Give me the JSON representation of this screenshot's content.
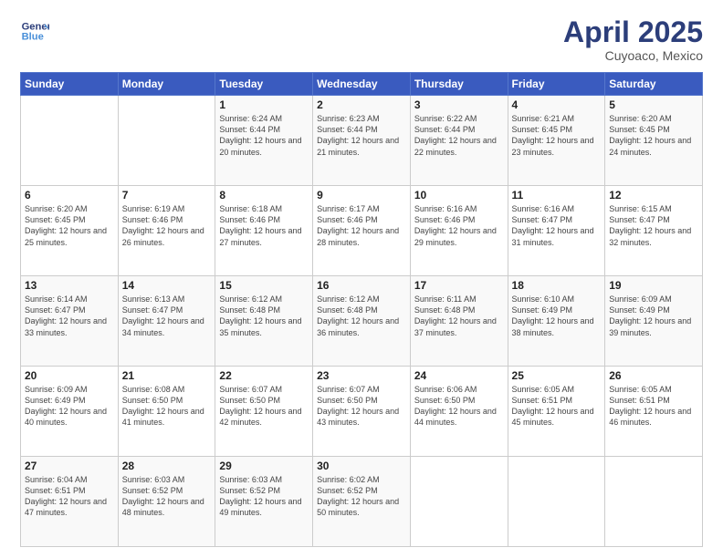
{
  "header": {
    "logo_line1": "General",
    "logo_line2": "Blue",
    "month_title": "April 2025",
    "subtitle": "Cuyoaco, Mexico"
  },
  "days_of_week": [
    "Sunday",
    "Monday",
    "Tuesday",
    "Wednesday",
    "Thursday",
    "Friday",
    "Saturday"
  ],
  "weeks": [
    [
      {
        "day": "",
        "info": ""
      },
      {
        "day": "",
        "info": ""
      },
      {
        "day": "1",
        "info": "Sunrise: 6:24 AM\nSunset: 6:44 PM\nDaylight: 12 hours and 20 minutes."
      },
      {
        "day": "2",
        "info": "Sunrise: 6:23 AM\nSunset: 6:44 PM\nDaylight: 12 hours and 21 minutes."
      },
      {
        "day": "3",
        "info": "Sunrise: 6:22 AM\nSunset: 6:44 PM\nDaylight: 12 hours and 22 minutes."
      },
      {
        "day": "4",
        "info": "Sunrise: 6:21 AM\nSunset: 6:45 PM\nDaylight: 12 hours and 23 minutes."
      },
      {
        "day": "5",
        "info": "Sunrise: 6:20 AM\nSunset: 6:45 PM\nDaylight: 12 hours and 24 minutes."
      }
    ],
    [
      {
        "day": "6",
        "info": "Sunrise: 6:20 AM\nSunset: 6:45 PM\nDaylight: 12 hours and 25 minutes."
      },
      {
        "day": "7",
        "info": "Sunrise: 6:19 AM\nSunset: 6:46 PM\nDaylight: 12 hours and 26 minutes."
      },
      {
        "day": "8",
        "info": "Sunrise: 6:18 AM\nSunset: 6:46 PM\nDaylight: 12 hours and 27 minutes."
      },
      {
        "day": "9",
        "info": "Sunrise: 6:17 AM\nSunset: 6:46 PM\nDaylight: 12 hours and 28 minutes."
      },
      {
        "day": "10",
        "info": "Sunrise: 6:16 AM\nSunset: 6:46 PM\nDaylight: 12 hours and 29 minutes."
      },
      {
        "day": "11",
        "info": "Sunrise: 6:16 AM\nSunset: 6:47 PM\nDaylight: 12 hours and 31 minutes."
      },
      {
        "day": "12",
        "info": "Sunrise: 6:15 AM\nSunset: 6:47 PM\nDaylight: 12 hours and 32 minutes."
      }
    ],
    [
      {
        "day": "13",
        "info": "Sunrise: 6:14 AM\nSunset: 6:47 PM\nDaylight: 12 hours and 33 minutes."
      },
      {
        "day": "14",
        "info": "Sunrise: 6:13 AM\nSunset: 6:47 PM\nDaylight: 12 hours and 34 minutes."
      },
      {
        "day": "15",
        "info": "Sunrise: 6:12 AM\nSunset: 6:48 PM\nDaylight: 12 hours and 35 minutes."
      },
      {
        "day": "16",
        "info": "Sunrise: 6:12 AM\nSunset: 6:48 PM\nDaylight: 12 hours and 36 minutes."
      },
      {
        "day": "17",
        "info": "Sunrise: 6:11 AM\nSunset: 6:48 PM\nDaylight: 12 hours and 37 minutes."
      },
      {
        "day": "18",
        "info": "Sunrise: 6:10 AM\nSunset: 6:49 PM\nDaylight: 12 hours and 38 minutes."
      },
      {
        "day": "19",
        "info": "Sunrise: 6:09 AM\nSunset: 6:49 PM\nDaylight: 12 hours and 39 minutes."
      }
    ],
    [
      {
        "day": "20",
        "info": "Sunrise: 6:09 AM\nSunset: 6:49 PM\nDaylight: 12 hours and 40 minutes."
      },
      {
        "day": "21",
        "info": "Sunrise: 6:08 AM\nSunset: 6:50 PM\nDaylight: 12 hours and 41 minutes."
      },
      {
        "day": "22",
        "info": "Sunrise: 6:07 AM\nSunset: 6:50 PM\nDaylight: 12 hours and 42 minutes."
      },
      {
        "day": "23",
        "info": "Sunrise: 6:07 AM\nSunset: 6:50 PM\nDaylight: 12 hours and 43 minutes."
      },
      {
        "day": "24",
        "info": "Sunrise: 6:06 AM\nSunset: 6:50 PM\nDaylight: 12 hours and 44 minutes."
      },
      {
        "day": "25",
        "info": "Sunrise: 6:05 AM\nSunset: 6:51 PM\nDaylight: 12 hours and 45 minutes."
      },
      {
        "day": "26",
        "info": "Sunrise: 6:05 AM\nSunset: 6:51 PM\nDaylight: 12 hours and 46 minutes."
      }
    ],
    [
      {
        "day": "27",
        "info": "Sunrise: 6:04 AM\nSunset: 6:51 PM\nDaylight: 12 hours and 47 minutes."
      },
      {
        "day": "28",
        "info": "Sunrise: 6:03 AM\nSunset: 6:52 PM\nDaylight: 12 hours and 48 minutes."
      },
      {
        "day": "29",
        "info": "Sunrise: 6:03 AM\nSunset: 6:52 PM\nDaylight: 12 hours and 49 minutes."
      },
      {
        "day": "30",
        "info": "Sunrise: 6:02 AM\nSunset: 6:52 PM\nDaylight: 12 hours and 50 minutes."
      },
      {
        "day": "",
        "info": ""
      },
      {
        "day": "",
        "info": ""
      },
      {
        "day": "",
        "info": ""
      }
    ]
  ]
}
